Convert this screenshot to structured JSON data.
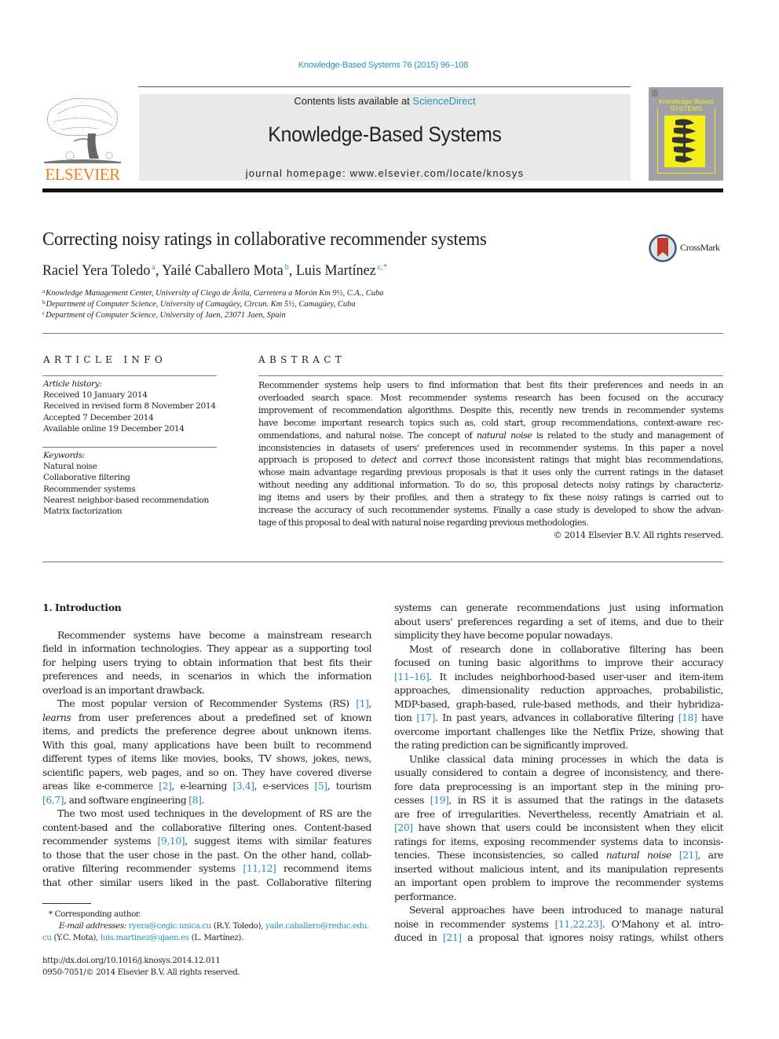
{
  "header": {
    "journal_reference": "Knowledge-Based Systems 76 (2015) 96–108",
    "publisher_logo_text": "ELSEVIER",
    "contents_prefix": "Contents lists available at ",
    "contents_link": "ScienceDirect",
    "journal_name": "Knowledge-Based Systems",
    "homepage_line": "journal homepage: www.elsevier.com/locate/knosys",
    "cover_title_line1": "Knowledge-Based",
    "cover_title_line2": "SYSTEMS"
  },
  "article": {
    "title": "Correcting noisy ratings in collaborative recommender systems",
    "crossmark_label": "CrossMark",
    "authors": [
      {
        "name": "Raciel Yera Toledo",
        "sup": "a",
        "sep": ", "
      },
      {
        "name": "Yailé Caballero Mota",
        "sup": "b",
        "sep": ", "
      },
      {
        "name": "Luis Martínez",
        "sup": "c,*",
        "sep": ""
      }
    ],
    "affiliations": [
      {
        "mark": "a",
        "text": "Knowledge Management Center, University of Ciego de Ávila, Carretera a Morón Km 9½, C.A., Cuba"
      },
      {
        "mark": "b",
        "text": "Department of Computer Science, University of Camagüey, Circun. Km 5½, Camagüey, Cuba"
      },
      {
        "mark": "c",
        "text": "Department of Computer Science, University of Jaen, 23071 Jaen, Spain"
      }
    ]
  },
  "article_info": {
    "heading": "ARTICLE INFO",
    "history_label": "Article history:",
    "history": [
      "Received 10 January 2014",
      "Received in revised form 8 November 2014",
      "Accepted 7 December 2014",
      "Available online 19 December 2014"
    ],
    "keywords_label": "Keywords:",
    "keywords": [
      "Natural noise",
      "Collaborative filtering",
      "Recommender systems",
      "Nearest neighbor-based recommendation",
      "Matrix factorization"
    ]
  },
  "abstract": {
    "heading": "ABSTRACT",
    "lines": [
      "Recommender systems help users to find information that best fits their preferences and needs in an",
      "overloaded search space. Most recommender systems research has been focused on the accuracy",
      "improvement of recommendation algorithms. Despite this, recently new trends in recommender systems",
      "have become important research topics such as, cold start, group recommendations, context-aware rec-",
      "ommendations, and natural noise. The concept of |natural noise| is related to the study and management of",
      "inconsistencies in datasets of users' preferences used in recommender systems. In this paper a novel",
      "approach is proposed to |detect| and |correct| those inconsistent ratings that might bias recommendations,",
      "whose main advantage regarding previous proposals is that it uses only the current ratings in the dataset",
      "without needing any additional information. To do so, this proposal detects noisy ratings by characteriz-",
      "ing items and users by their profiles, and then a strategy to fix these noisy ratings is carried out to",
      "increase the accuracy of such recommender systems. Finally a case study is developed to show the advan-",
      "tage of this proposal to deal with natural noise regarding previous methodologies."
    ],
    "copyright": "© 2014 Elsevier B.V. All rights reserved."
  },
  "body": {
    "section_heading": "1. Introduction",
    "left_column": [
      {
        "t": "",
        "cls": "gap"
      },
      {
        "t": "Recommender systems have become a mainstream research",
        "cls": "ind"
      },
      {
        "t": "field in information technologies. They appear as a supporting tool"
      },
      {
        "t": "for helping users trying to obtain information that best fits their"
      },
      {
        "t": "preferences and needs, in scenarios in which the information"
      },
      {
        "t": "overload is an important drawback.",
        "cls": "last"
      },
      {
        "t": "The most popular version of Recommender Systems (RS) {[1]},",
        "cls": "ind"
      },
      {
        "t": "|learns| from user preferences about a predefined set of known"
      },
      {
        "t": "items, and predicts the preference degree about unknown items."
      },
      {
        "t": "With this goal, many applications have been built to recommend"
      },
      {
        "t": "different types of items like movies, books, TV shows, jokes, news,"
      },
      {
        "t": "scientific papers, web pages, and so on. They have covered diverse"
      },
      {
        "t": "areas like e-commerce {[2]}, e-learning {[3,4]}, e-services {[5]}, tourism"
      },
      {
        "t": "{[6,7]}, and software engineering {[8]}.",
        "cls": "last"
      },
      {
        "t": "The two most used techniques in the development of RS are the",
        "cls": "ind"
      },
      {
        "t": "content-based and the collaborative filtering ones. Content-based"
      },
      {
        "t": "recommender systems {[9,10]}, suggest items with similar features"
      },
      {
        "t": "to those that the user chose in the past. On the other hand, collab-"
      },
      {
        "t": "orative filtering recommender systems {[11,12]} recommend items"
      },
      {
        "t": "that other similar users liked in the past. Collaborative filtering"
      }
    ],
    "right_column": [
      {
        "t": "systems can generate recommendations just using information"
      },
      {
        "t": "about users' preferences regarding a set of items, and due to their"
      },
      {
        "t": "simplicity they have become popular nowadays.",
        "cls": "last"
      },
      {
        "t": "Most of research done in collaborative filtering has been",
        "cls": "ind"
      },
      {
        "t": "focused on tuning basic algorithms to improve their accuracy"
      },
      {
        "t": "{[11–16]}. It includes neighborhood-based user-user and item-item"
      },
      {
        "t": "approaches, dimensionality reduction approaches, probabilistic,"
      },
      {
        "t": "MDP-based, graph-based, rule-based methods, and their hybridiza-"
      },
      {
        "t": "tion {[17]}. In past years, advances in collaborative filtering {[18]} have"
      },
      {
        "t": "overcome important challenges like the Netflix Prize, showing that"
      },
      {
        "t": "the rating prediction can be significantly improved.",
        "cls": "last"
      },
      {
        "t": "Unlike classical data mining processes in which the data is",
        "cls": "ind"
      },
      {
        "t": "usually considered to contain a degree of inconsistency, and there-"
      },
      {
        "t": "fore data preprocessing is an important step in the mining pro-"
      },
      {
        "t": "cesses {[19]}, in RS it is assumed that the ratings in the datasets"
      },
      {
        "t": "are free of irregularities. Nevertheless, recently Amatriain et al."
      },
      {
        "t": "{[20]} have shown that users could be inconsistent when they elicit"
      },
      {
        "t": "ratings for items, exposing recommender systems data to inconsis-"
      },
      {
        "t": "tencies. These inconsistencies, so called |natural noise| {[21]}, are"
      },
      {
        "t": "inserted without malicious intent, and its manipulation represents"
      },
      {
        "t": "an important open problem to improve the recommender systems"
      },
      {
        "t": "performance.",
        "cls": "last"
      },
      {
        "t": "Several approaches have been introduced to manage natural",
        "cls": "ind"
      },
      {
        "t": "noise in recommender systems {[11,22,23]}. O'Mahony et al. intro-"
      },
      {
        "t": "duced in {[21]} a proposal that ignores noisy ratings, whilst others"
      }
    ]
  },
  "footnotes": {
    "corresponding": "* Corresponding author.",
    "email_label": "E-mail addresses:",
    "emails": [
      {
        "address": "ryera@cegic.unica.cu",
        "owner": "(R.Y. Toledo), "
      },
      {
        "address": "yaile.caballero@reduc.edu.",
        "owner": ""
      },
      {
        "address": "cu",
        "owner": " (Y.C. Mota), "
      },
      {
        "address": "luis.martinez@ujaen.es",
        "owner": " (L. Martínez)."
      }
    ],
    "doi": "http://dx.doi.org/10.1016/j.knosys.2014.12.011",
    "issn_line": "0950-7051/© 2014 Elsevier B.V. All rights reserved."
  },
  "colors": {
    "link": "#2a8fbd",
    "elsevier_orange": "#f07f1a",
    "banner_gray": "#e9e9e9",
    "cover_gray": "#a0a0a6",
    "cover_yellow": "#f4ee1a",
    "crossmark_red": "#c0392b"
  }
}
